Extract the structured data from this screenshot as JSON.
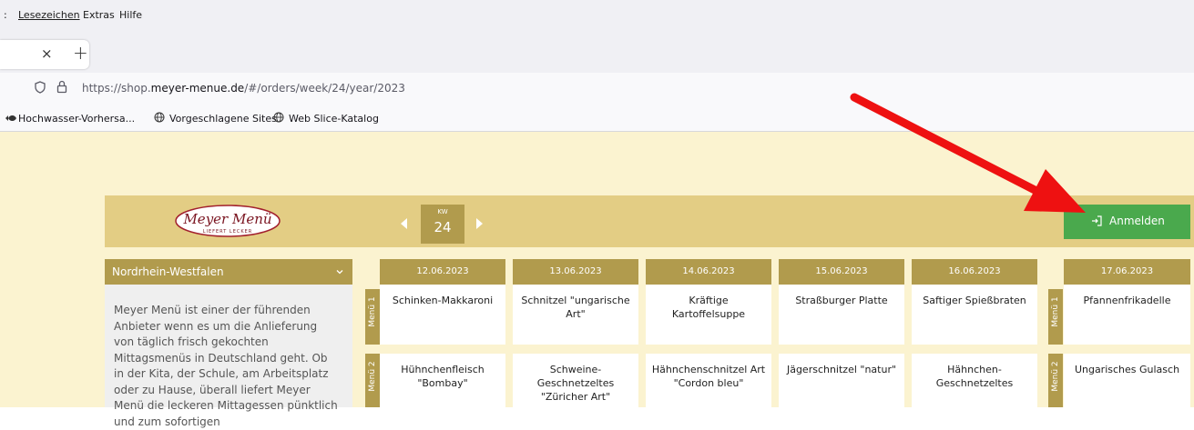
{
  "menubar": {
    "items": [
      ":",
      "Lesezeichen",
      "Extras",
      "Hilfe"
    ]
  },
  "tabbar": {
    "close": "×",
    "new_tab": "+"
  },
  "address": {
    "prefix": "https://shop.",
    "domain": "meyer-menue.de",
    "path": "/#/orders/week/24/year/2023"
  },
  "bookmarks": [
    "Hochwasser-Vorhersa...",
    "Vorgeschlagene Sites",
    "Web Slice-Katalog"
  ],
  "header": {
    "logo_text": "Meyer Menü",
    "logo_tagline": "LIEFERT LECKER",
    "kw_label": "KW",
    "kw_number": "24",
    "login_label": "Anmelden"
  },
  "region": {
    "title": "Nordrhein-Westfalen",
    "description": "Meyer Menü ist einer der führenden Anbieter wenn es um die Anlieferung von täglich frisch gekochten Mittagsmenüs in Deutschland geht. Ob in der Kita, der Schule, am Arbeitsplatz oder zu Hause, überall liefert Meyer Menü die leckeren Mittagessen pünktlich und zum sofortigen"
  },
  "menu_labels": [
    "Menü 1",
    "Menü 2"
  ],
  "days": [
    {
      "date": "12.06.2023",
      "menu1": "Schinken-Makkaroni",
      "menu2": "Hühnchenfleisch \"Bombay\""
    },
    {
      "date": "13.06.2023",
      "menu1": "Schnitzel \"ungarische Art\"",
      "menu2": "Schweine-Geschnetzeltes \"Züricher Art\""
    },
    {
      "date": "14.06.2023",
      "menu1": "Kräftige Kartoffelsuppe",
      "menu2": "Hähnchenschnitzel Art \"Cordon bleu\""
    },
    {
      "date": "15.06.2023",
      "menu1": "Straßburger Platte",
      "menu2": "Jägerschnitzel \"natur\""
    },
    {
      "date": "16.06.2023",
      "menu1": "Saftiger Spießbraten",
      "menu2": "Hähnchen-Geschnetzeltes"
    },
    {
      "date": "17.06.2023",
      "menu1": "Pfannenfrikadelle",
      "menu2": "Ungarisches Gulasch"
    }
  ]
}
